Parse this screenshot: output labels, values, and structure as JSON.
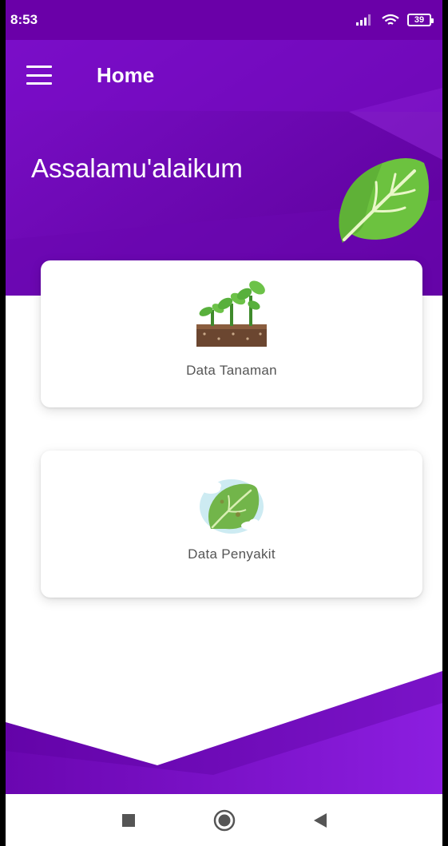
{
  "status_bar": {
    "time": "8:53",
    "battery": "39",
    "icons": [
      "signal-icon",
      "wifi-icon",
      "battery-icon"
    ]
  },
  "app_bar": {
    "title": "Home",
    "menu_icon": "menu-icon"
  },
  "header": {
    "greeting": "Assalamu'alaikum",
    "logo_icon": "leaf-icon"
  },
  "cards": [
    {
      "label": "Data Tanaman",
      "icon": "plant-sprouts-icon"
    },
    {
      "label": "Data Penyakit",
      "icon": "diseased-leaf-icon"
    }
  ],
  "nav_bar": {
    "buttons": [
      "recent-apps-button",
      "home-button",
      "back-button"
    ]
  },
  "colors": {
    "primary_dark": "#5a0096",
    "primary": "#7a0ec9",
    "primary_light": "#9a2be0",
    "leaf_green": "#5fb33a",
    "card_text": "#555555"
  }
}
